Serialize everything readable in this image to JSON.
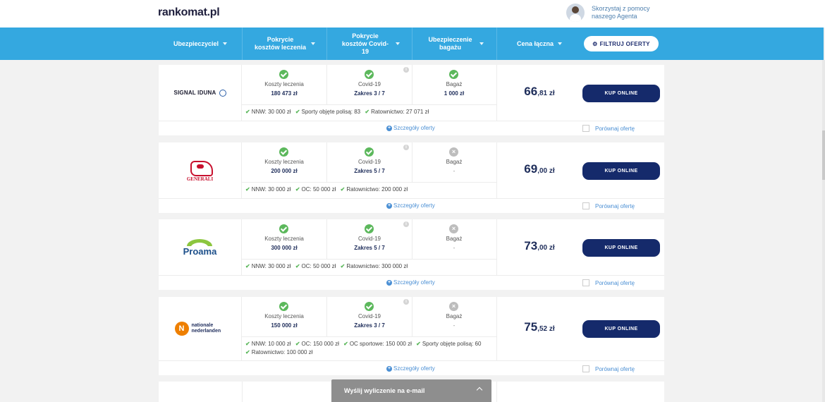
{
  "header": {
    "logo": "rankomat.pl",
    "agent_text": "Skorzystaj z pomocy naszego Agenta"
  },
  "filters": {
    "insurer": "Ubezpieczyciel",
    "treatment": "Pokrycie kosztów leczenia",
    "covid": "Pokrycie kosztów Covid-19",
    "baggage": "Ubezpieczenie bagażu",
    "price": "Cena łączna",
    "filter_button": "FILTRUJ OFERTY"
  },
  "labels": {
    "treatment": "Koszty leczenia",
    "covid": "Covid-19",
    "baggage": "Bagaż",
    "buy": "KUP ONLINE",
    "details": "Szczegóły oferty",
    "compare": "Porównaj ofertę"
  },
  "offers": [
    {
      "insurer": "SIGNAL IDUNA",
      "treatment": "180 473 zł",
      "covid": "Zakres 3 / 7",
      "baggage_ok": true,
      "baggage": "1 000 zł",
      "extras": [
        "NNW: 30 000 zł",
        "Sporty objęte polisą: 83",
        "Ratownictwo: 27 071 zł"
      ],
      "price_big": "66",
      "price_small": ",81 zł"
    },
    {
      "insurer": "GENERALI",
      "treatment": "200 000 zł",
      "covid": "Zakres 5 / 7",
      "baggage_ok": false,
      "baggage": "-",
      "extras": [
        "NNW: 30 000 zł",
        "OC: 50 000 zł",
        "Ratownictwo: 200 000 zł"
      ],
      "price_big": "69",
      "price_small": ",00 zł"
    },
    {
      "insurer": "Proama",
      "treatment": "300 000 zł",
      "covid": "Zakres 5 / 7",
      "baggage_ok": false,
      "baggage": "-",
      "extras": [
        "NNW: 30 000 zł",
        "OC: 50 000 zł",
        "Ratownictwo: 300 000 zł"
      ],
      "price_big": "73",
      "price_small": ",00 zł"
    },
    {
      "insurer": "nationale nederlanden",
      "treatment": "150 000 zł",
      "covid": "Zakres 3 / 7",
      "baggage_ok": false,
      "baggage": "-",
      "extras": [
        "NNW: 10 000 zł",
        "OC: 150 000 zł",
        "OC sportowe: 150 000 zł",
        "Sporty objęte polisą: 60",
        "Ratownictwo: 100 000 zł"
      ],
      "price_big": "75",
      "price_small": ",52 zł"
    }
  ],
  "toast": {
    "label": "Wyślij wyliczenie na e-mail"
  },
  "colors": {
    "filter_bar": "#34a8e0",
    "buy_button": "#152a6b",
    "ok": "#5cb85c"
  }
}
